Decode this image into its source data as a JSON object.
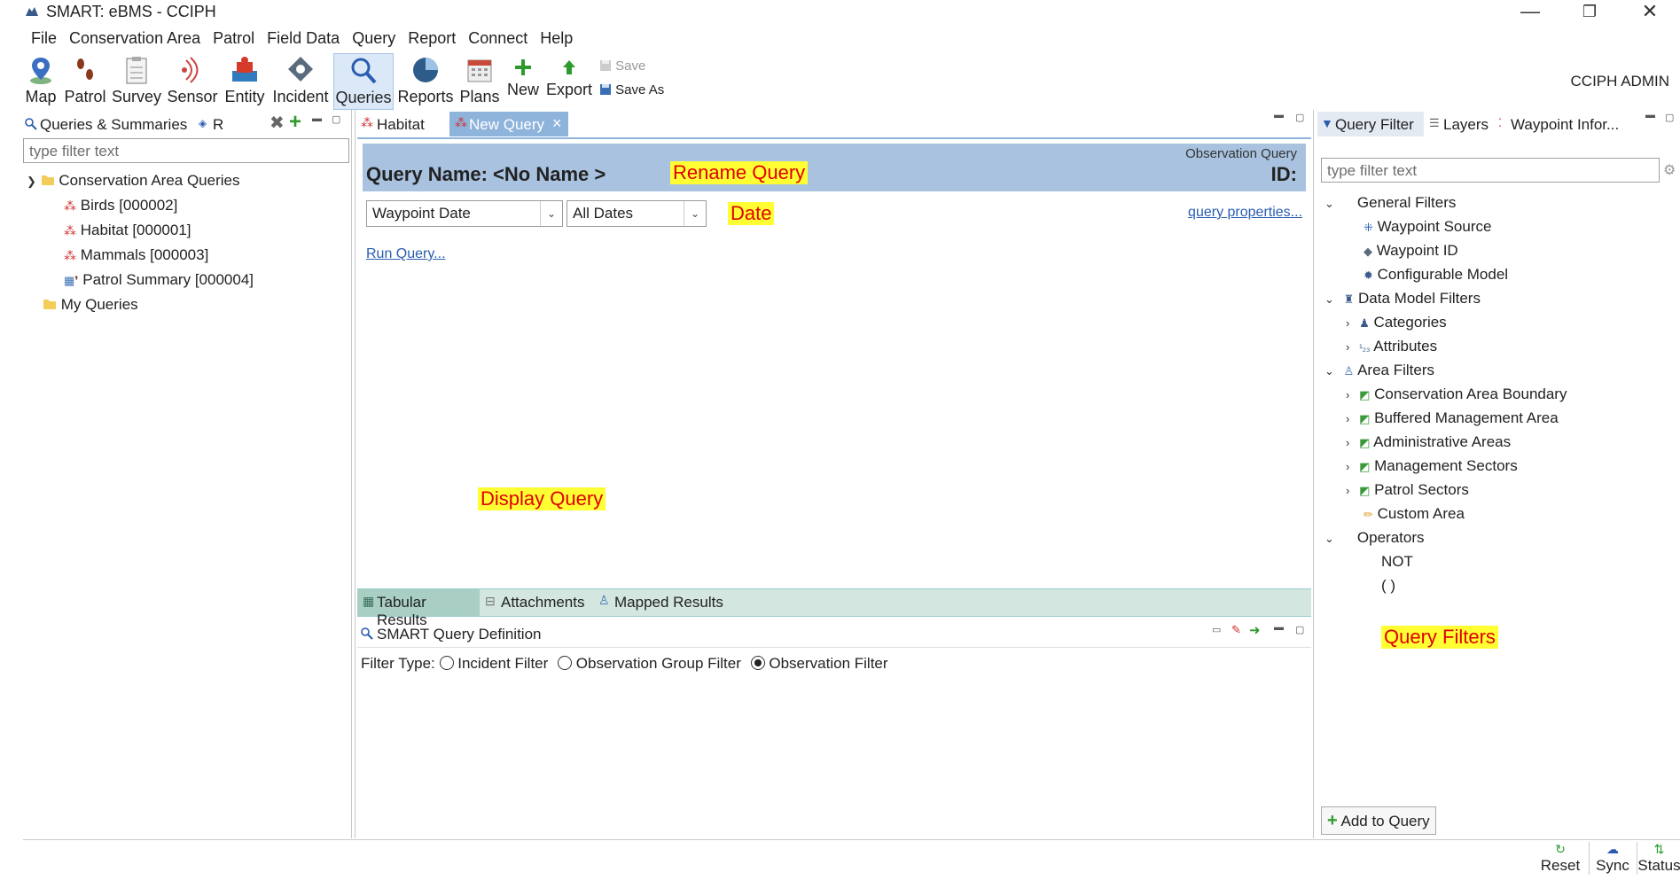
{
  "window": {
    "title": "SMART: eBMS - CCIPH",
    "minimize": "—",
    "restore": "❐",
    "close": "✕"
  },
  "menu": [
    "File",
    "Conservation Area",
    "Patrol",
    "Field Data",
    "Query",
    "Report",
    "Connect",
    "Help"
  ],
  "toolbar": {
    "map": "Map",
    "patrol": "Patrol",
    "survey": "Survey",
    "sensor": "Sensor",
    "entity": "Entity",
    "incident": "Incident",
    "queries": "Queries",
    "reports": "Reports",
    "plans": "Plans",
    "new": "New",
    "export": "Export",
    "save": "Save",
    "save_as": "Save As"
  },
  "user": "CCIPH ADMIN",
  "left_panel": {
    "tab": "Queries & Summaries",
    "tab2": "R",
    "filter_placeholder": "type filter text",
    "root": "Conservation Area Queries",
    "items": [
      "Birds [000002]",
      "Habitat [000001]",
      "Mammals [000003]",
      "Patrol Summary [000004]"
    ],
    "my_queries": "My Queries"
  },
  "editor": {
    "tabs": [
      "Habitat",
      "New Query"
    ],
    "tab_close": "×",
    "query_type": "Observation Query",
    "query_name": "Query Name: <No Name >",
    "id_label": "ID:",
    "date_field": "Waypoint Date",
    "date_range": "All Dates",
    "query_properties": "query properties...",
    "run_query": "Run Query..."
  },
  "annotations": {
    "rename": "Rename Query",
    "date": "Date",
    "display": "Display Query",
    "filters": "Query Filters"
  },
  "results_tabs": [
    "Tabular Results",
    "Attachments",
    "Mapped Results"
  ],
  "definition": {
    "title": "SMART Query Definition",
    "filter_type_label": "Filter Type:",
    "options": [
      "Incident Filter",
      "Observation Group Filter",
      "Observation Filter"
    ],
    "selected": "Observation Filter"
  },
  "right_panel": {
    "tabs": [
      "Query Filter",
      "Layers",
      "Waypoint Infor..."
    ],
    "filter_placeholder": "type filter text",
    "general": "General Filters",
    "general_items": [
      "Waypoint Source",
      "Waypoint ID",
      "Configurable Model"
    ],
    "data_model": "Data Model Filters",
    "data_model_items": [
      "Categories",
      "Attributes"
    ],
    "area": "Area Filters",
    "area_items": [
      "Conservation Area Boundary",
      "Buffered Management Area",
      "Administrative Areas",
      "Management Sectors",
      "Patrol Sectors",
      "Custom Area"
    ],
    "operators": "Operators",
    "operator_items": [
      "NOT",
      "( )"
    ],
    "add_button": "Add to Query"
  },
  "status": {
    "reset": "Reset",
    "sync": "Sync",
    "status": "Status"
  }
}
